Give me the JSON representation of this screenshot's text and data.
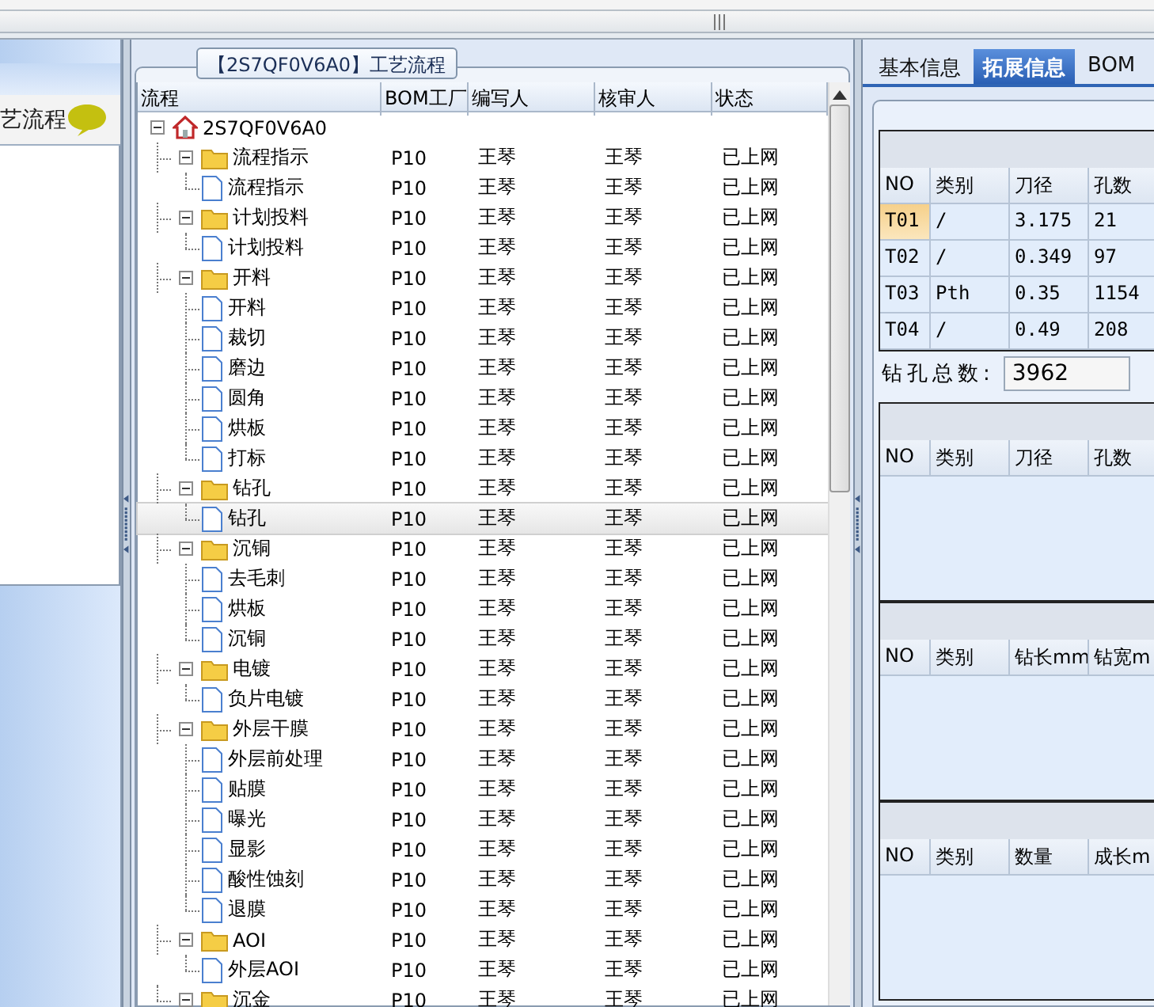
{
  "left_panel": {
    "title": "艺流程"
  },
  "process_panel": {
    "title": "【2S7QF0V6A0】工艺流程",
    "columns": [
      "流程",
      "BOM工厂",
      "编写人",
      "核审人",
      "状态"
    ],
    "tree": [
      {
        "name": "2S7QF0V6A0",
        "kind": "root",
        "expanded": true,
        "selected": false,
        "children": [
          {
            "name": "流程指示",
            "kind": "group",
            "expanded": true,
            "selected": false,
            "bom_factory": "P10",
            "writer": "王琴",
            "reviewer": "王琴",
            "status": "已上网",
            "children": [
              {
                "name": "流程指示",
                "kind": "step",
                "selected": false,
                "bom_factory": "P10",
                "writer": "王琴",
                "reviewer": "王琴",
                "status": "已上网"
              }
            ]
          },
          {
            "name": "计划投料",
            "kind": "group",
            "expanded": true,
            "selected": false,
            "bom_factory": "P10",
            "writer": "王琴",
            "reviewer": "王琴",
            "status": "已上网",
            "children": [
              {
                "name": "计划投料",
                "kind": "step",
                "selected": false,
                "bom_factory": "P10",
                "writer": "王琴",
                "reviewer": "王琴",
                "status": "已上网"
              }
            ]
          },
          {
            "name": "开料",
            "kind": "group",
            "expanded": true,
            "selected": false,
            "bom_factory": "P10",
            "writer": "王琴",
            "reviewer": "王琴",
            "status": "已上网",
            "children": [
              {
                "name": "开料",
                "kind": "step",
                "selected": false,
                "bom_factory": "P10",
                "writer": "王琴",
                "reviewer": "王琴",
                "status": "已上网"
              },
              {
                "name": "裁切",
                "kind": "step",
                "selected": false,
                "bom_factory": "P10",
                "writer": "王琴",
                "reviewer": "王琴",
                "status": "已上网"
              },
              {
                "name": "磨边",
                "kind": "step",
                "selected": false,
                "bom_factory": "P10",
                "writer": "王琴",
                "reviewer": "王琴",
                "status": "已上网"
              },
              {
                "name": "圆角",
                "kind": "step",
                "selected": false,
                "bom_factory": "P10",
                "writer": "王琴",
                "reviewer": "王琴",
                "status": "已上网"
              },
              {
                "name": "烘板",
                "kind": "step",
                "selected": false,
                "bom_factory": "P10",
                "writer": "王琴",
                "reviewer": "王琴",
                "status": "已上网"
              },
              {
                "name": "打标",
                "kind": "step",
                "selected": false,
                "bom_factory": "P10",
                "writer": "王琴",
                "reviewer": "王琴",
                "status": "已上网"
              }
            ]
          },
          {
            "name": "钻孔",
            "kind": "group",
            "expanded": true,
            "selected": false,
            "bom_factory": "P10",
            "writer": "王琴",
            "reviewer": "王琴",
            "status": "已上网",
            "children": [
              {
                "name": "钻孔",
                "kind": "step",
                "selected": true,
                "bom_factory": "P10",
                "writer": "王琴",
                "reviewer": "王琴",
                "status": "已上网"
              }
            ]
          },
          {
            "name": "沉铜",
            "kind": "group",
            "expanded": true,
            "selected": false,
            "bom_factory": "P10",
            "writer": "王琴",
            "reviewer": "王琴",
            "status": "已上网",
            "children": [
              {
                "name": "去毛刺",
                "kind": "step",
                "selected": false,
                "bom_factory": "P10",
                "writer": "王琴",
                "reviewer": "王琴",
                "status": "已上网"
              },
              {
                "name": "烘板",
                "kind": "step",
                "selected": false,
                "bom_factory": "P10",
                "writer": "王琴",
                "reviewer": "王琴",
                "status": "已上网"
              },
              {
                "name": "沉铜",
                "kind": "step",
                "selected": false,
                "bom_factory": "P10",
                "writer": "王琴",
                "reviewer": "王琴",
                "status": "已上网"
              }
            ]
          },
          {
            "name": "电镀",
            "kind": "group",
            "expanded": true,
            "selected": false,
            "bom_factory": "P10",
            "writer": "王琴",
            "reviewer": "王琴",
            "status": "已上网",
            "children": [
              {
                "name": "负片电镀",
                "kind": "step",
                "selected": false,
                "bom_factory": "P10",
                "writer": "王琴",
                "reviewer": "王琴",
                "status": "已上网"
              }
            ]
          },
          {
            "name": "外层干膜",
            "kind": "group",
            "expanded": true,
            "selected": false,
            "bom_factory": "P10",
            "writer": "王琴",
            "reviewer": "王琴",
            "status": "已上网",
            "children": [
              {
                "name": "外层前处理",
                "kind": "step",
                "selected": false,
                "bom_factory": "P10",
                "writer": "王琴",
                "reviewer": "王琴",
                "status": "已上网"
              },
              {
                "name": "贴膜",
                "kind": "step",
                "selected": false,
                "bom_factory": "P10",
                "writer": "王琴",
                "reviewer": "王琴",
                "status": "已上网"
              },
              {
                "name": "曝光",
                "kind": "step",
                "selected": false,
                "bom_factory": "P10",
                "writer": "王琴",
                "reviewer": "王琴",
                "status": "已上网"
              },
              {
                "name": "显影",
                "kind": "step",
                "selected": false,
                "bom_factory": "P10",
                "writer": "王琴",
                "reviewer": "王琴",
                "status": "已上网"
              },
              {
                "name": "酸性蚀刻",
                "kind": "step",
                "selected": false,
                "bom_factory": "P10",
                "writer": "王琴",
                "reviewer": "王琴",
                "status": "已上网"
              },
              {
                "name": "退膜",
                "kind": "step",
                "selected": false,
                "bom_factory": "P10",
                "writer": "王琴",
                "reviewer": "王琴",
                "status": "已上网"
              }
            ]
          },
          {
            "name": "AOI",
            "kind": "group",
            "expanded": true,
            "selected": false,
            "bom_factory": "P10",
            "writer": "王琴",
            "reviewer": "王琴",
            "status": "已上网",
            "children": [
              {
                "name": "外层AOI",
                "kind": "step",
                "selected": false,
                "bom_factory": "P10",
                "writer": "王琴",
                "reviewer": "王琴",
                "status": "已上网"
              }
            ]
          },
          {
            "name": "沉金",
            "kind": "group",
            "expanded": true,
            "selected": false,
            "bom_factory": "P10",
            "writer": "王琴",
            "reviewer": "王琴",
            "status": "已上网"
          }
        ]
      }
    ]
  },
  "detail_panel": {
    "tabs": [
      {
        "label": "基本信息",
        "selected": false
      },
      {
        "label": "拓展信息",
        "selected": true
      },
      {
        "label": "BOM",
        "selected": false
      }
    ],
    "drill_table": {
      "columns": [
        "NO",
        "类别",
        "刀径",
        "孔数"
      ],
      "rows": [
        {
          "cells": [
            "T01",
            "/",
            "3.175",
            "21"
          ],
          "selected": true
        },
        {
          "cells": [
            "T02",
            "/",
            "0.349",
            "97"
          ],
          "selected": false
        },
        {
          "cells": [
            "T03",
            "Pth",
            "0.35",
            "1154"
          ],
          "selected": false
        },
        {
          "cells": [
            "T04",
            "/",
            "0.49",
            "208"
          ],
          "selected": false
        }
      ]
    },
    "drill_total": {
      "label": "钻孔总数:",
      "value": "3962"
    },
    "tables": [
      {
        "columns": [
          "NO",
          "类别",
          "刀径",
          "孔数"
        ]
      },
      {
        "columns": [
          "NO",
          "类别",
          "钻长mm",
          "钻宽m"
        ]
      },
      {
        "columns": [
          "NO",
          "类别",
          "数量",
          "成长m"
        ]
      }
    ]
  }
}
